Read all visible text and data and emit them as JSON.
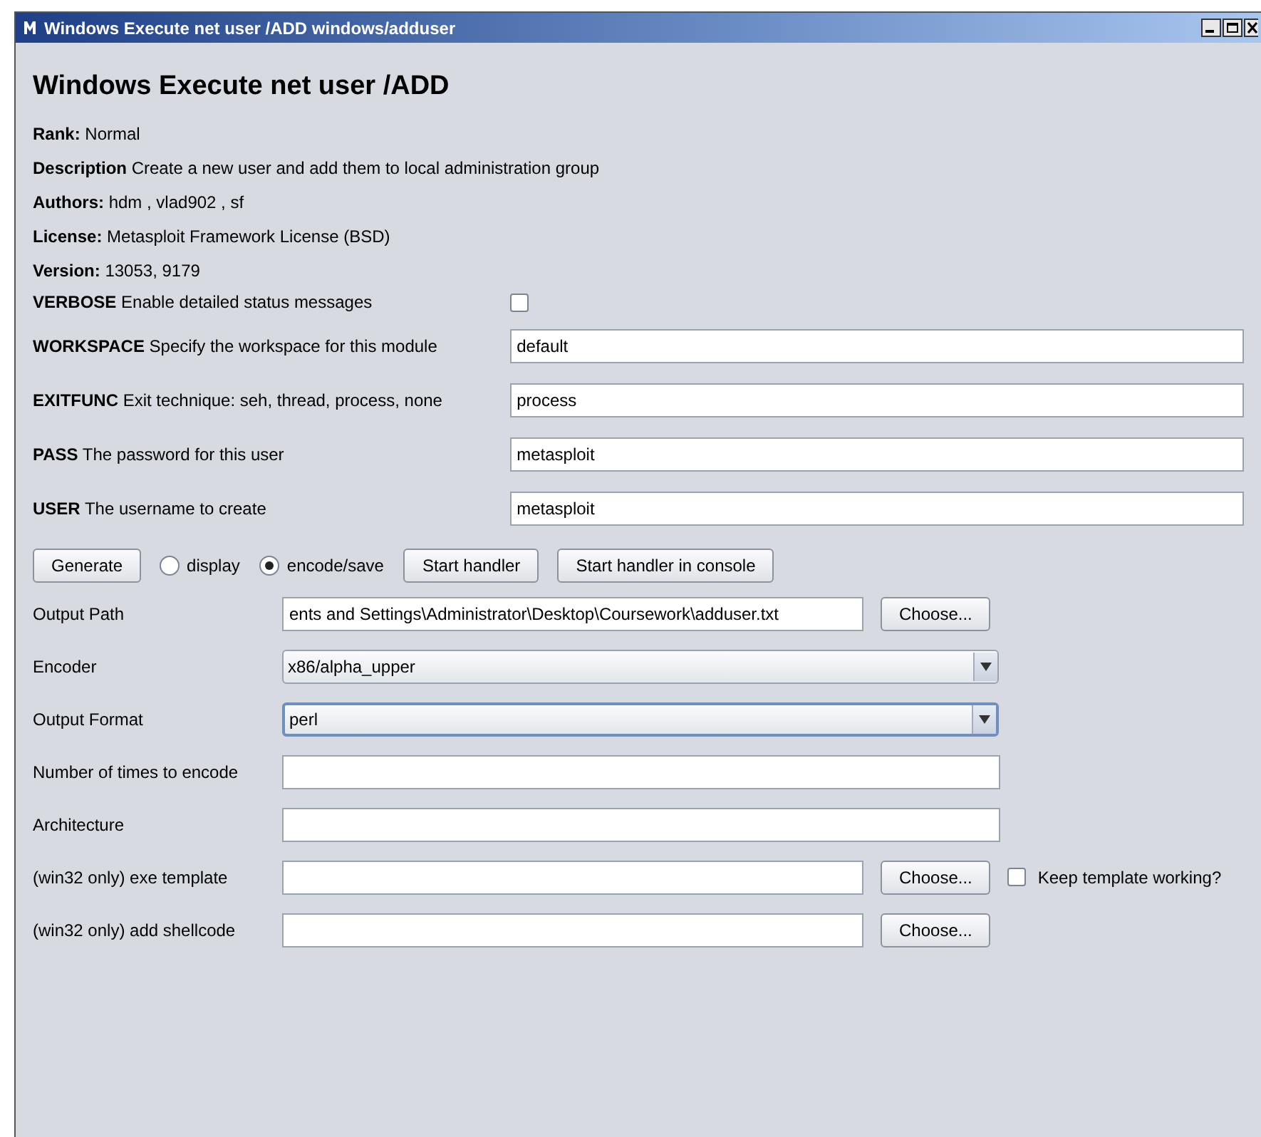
{
  "window": {
    "title": "Windows Execute net user /ADD windows/adduser"
  },
  "module": {
    "heading": "Windows Execute net user /ADD",
    "info": [
      {
        "label": "Rank:",
        "value": "Normal"
      },
      {
        "label": "Description",
        "value": "Create a new user and add them to local administration group"
      },
      {
        "label": "Authors:",
        "value": "hdm , vlad902 , sf"
      },
      {
        "label": "License:",
        "value": "Metasploit Framework License (BSD)"
      },
      {
        "label": "Version:",
        "value": "13053, 9179"
      }
    ]
  },
  "options": [
    {
      "kind": "checkbox",
      "name": "VERBOSE",
      "description": "Enable detailed status messages",
      "checked": false
    },
    {
      "kind": "text",
      "name": "WORKSPACE",
      "description": "Specify the workspace for this module",
      "value": "default"
    },
    {
      "kind": "text",
      "name": "EXITFUNC",
      "description": "Exit technique: seh, thread, process, none",
      "value": "process"
    },
    {
      "kind": "text",
      "name": "PASS",
      "description": "The password for this user",
      "value": "metasploit"
    },
    {
      "kind": "text",
      "name": "USER",
      "description": "The username to create",
      "value": "metasploit"
    }
  ],
  "action_bar": [
    {
      "kind": "button",
      "label": "Generate"
    },
    {
      "kind": "radio",
      "label": "display",
      "selected": false
    },
    {
      "kind": "radio",
      "label": "encode/save",
      "selected": true
    },
    {
      "kind": "button",
      "label": "Start handler"
    },
    {
      "kind": "button",
      "label": "Start handler in console"
    }
  ],
  "payload_fields": [
    {
      "kind": "path",
      "label": "Output Path",
      "value": "ents and Settings\\Administrator\\Desktop\\Coursework\\adduser.txt",
      "button": "Choose..."
    },
    {
      "kind": "select",
      "label": "Encoder",
      "value": "x86/alpha_upper",
      "focused": false
    },
    {
      "kind": "select",
      "label": "Output Format",
      "value": "perl",
      "focused": true
    },
    {
      "kind": "text",
      "label": "Number of times to encode"
    },
    {
      "kind": "text",
      "label": "Architecture"
    },
    {
      "kind": "path",
      "label": "(win32 only) exe template",
      "button": "Choose...",
      "checkbox": {
        "label": "Keep template working?",
        "checked": false
      }
    },
    {
      "kind": "path",
      "label": "(win32 only) add shellcode",
      "button": "Choose..."
    }
  ]
}
